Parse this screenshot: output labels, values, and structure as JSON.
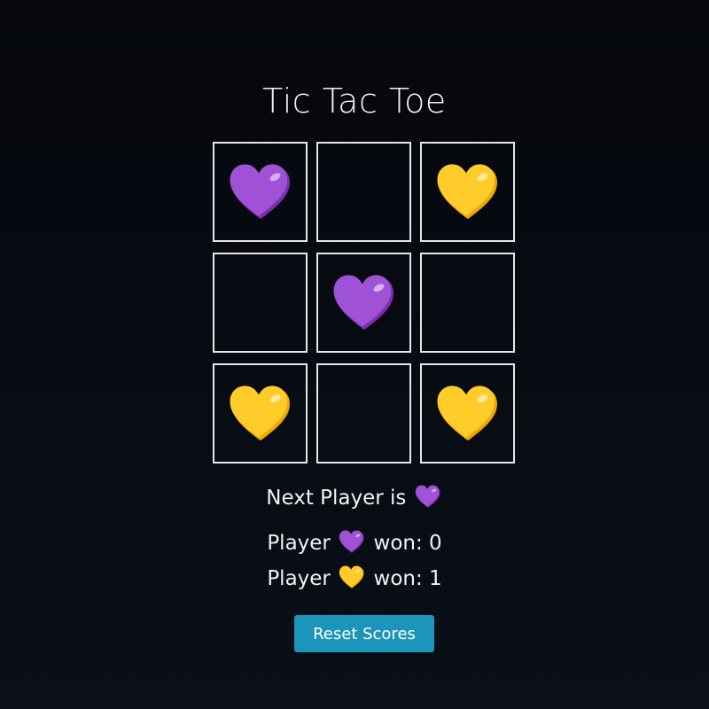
{
  "game": {
    "title": "Tic Tac Toe",
    "board": [
      "purple-heart",
      "",
      "yellow-heart",
      "",
      "purple-heart",
      "",
      "yellow-heart",
      "",
      "yellow-heart"
    ]
  },
  "status": {
    "prefix": "Next Player is",
    "next_player": "purple-heart"
  },
  "scores": [
    {
      "prefix": "Player",
      "icon": "purple-heart",
      "suffix": "won: 0"
    },
    {
      "prefix": "Player",
      "icon": "yellow-heart",
      "suffix": "won: 1"
    }
  ],
  "controls": {
    "reset_label": "Reset Scores"
  },
  "colors": {
    "purple_heart": "#a052d6",
    "purple_heart_shade": "#7b2fb0",
    "yellow_heart": "#ffcc2a",
    "yellow_heart_shade": "#f0a500",
    "cell_border": "#e6e6e6",
    "button_bg": "#1b95b9"
  }
}
